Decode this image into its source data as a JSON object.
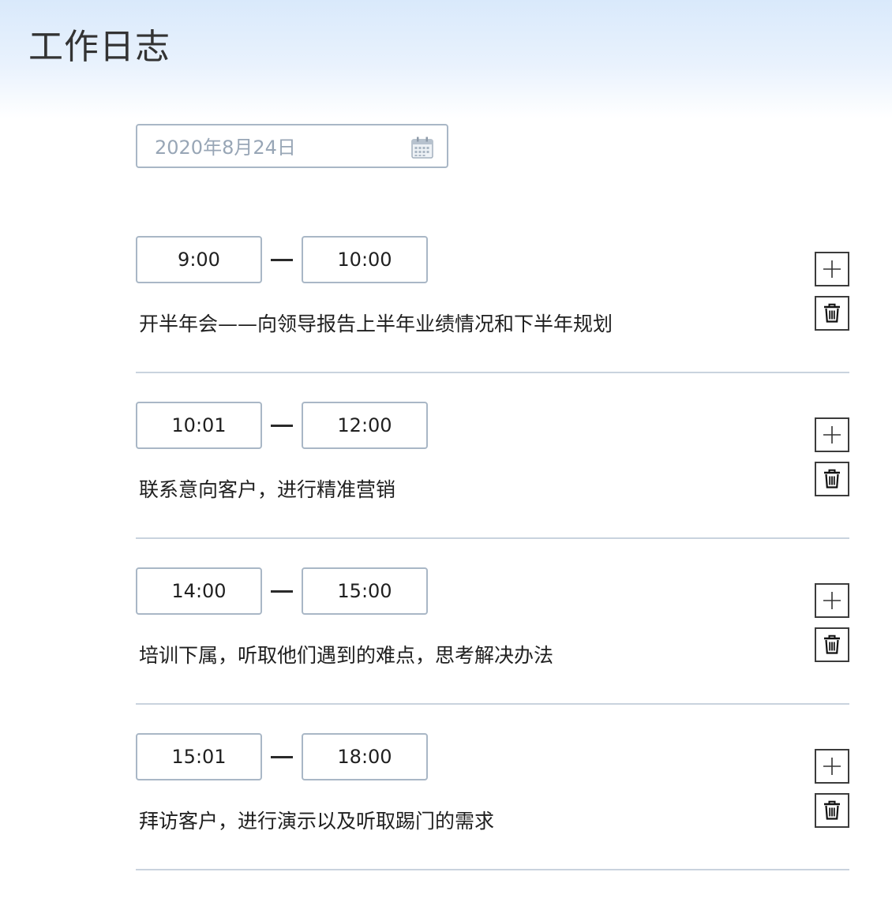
{
  "header": {
    "title": "工作日志"
  },
  "date_picker": {
    "value": "2020年8月24日",
    "icon": "calendar-icon"
  },
  "entries": [
    {
      "start": "9:00",
      "end": "10:00",
      "description": "开半年会——向领导报告上半年业绩情况和下半年规划"
    },
    {
      "start": "10:01",
      "end": "12:00",
      "description": "联系意向客户，进行精准营销"
    },
    {
      "start": "14:00",
      "end": "15:00",
      "description": "培训下属，听取他们遇到的难点，思考解决办法"
    },
    {
      "start": "15:01",
      "end": "18:00",
      "description": "拜访客户，进行演示以及听取踢门的需求"
    }
  ],
  "icons": {
    "add": "plus-icon",
    "delete": "trash-icon"
  },
  "colors": {
    "header_gradient_top": "#d9e9fb",
    "field_border": "#a9b7c6",
    "placeholder_text": "#98a6b6",
    "divider": "#c9d3de"
  }
}
